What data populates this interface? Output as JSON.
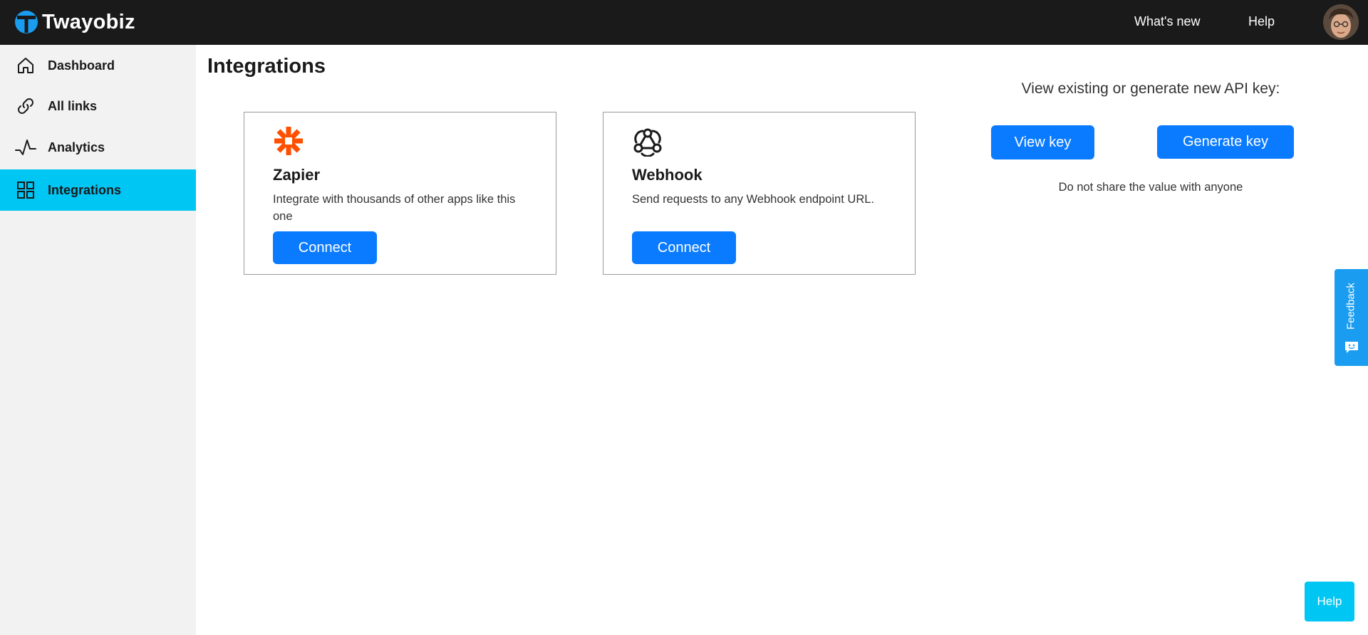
{
  "header": {
    "brand_name": "Twayobiz",
    "nav": {
      "whats_new": "What's new",
      "help": "Help"
    }
  },
  "sidebar": {
    "items": [
      {
        "label": "Dashboard",
        "icon": "home-icon",
        "active": false
      },
      {
        "label": "All links",
        "icon": "link-icon",
        "active": false
      },
      {
        "label": "Analytics",
        "icon": "pulse-icon",
        "active": false
      },
      {
        "label": "Integrations",
        "icon": "grid-icon",
        "active": true
      }
    ]
  },
  "main": {
    "title": "Integrations",
    "cards": [
      {
        "title": "Zapier",
        "icon": "zapier-asterisk-icon",
        "description": "Integrate with thousands of other apps like this one",
        "button": "Connect"
      },
      {
        "title": "Webhook",
        "icon": "webhook-icon",
        "description": "Send requests to any Webhook endpoint URL.",
        "button": "Connect"
      }
    ],
    "api": {
      "heading": "View existing or generate new API key:",
      "view_button": "View key",
      "generate_button": "Generate key",
      "note": "Do not share the value with anyone"
    }
  },
  "feedback_tab": {
    "label": "Feedback"
  },
  "help_button": {
    "label": "Help"
  },
  "colors": {
    "topbar": "#1a1a1a",
    "sidebar": "#f2f2f2",
    "active_item": "#00c6f3",
    "primary_button": "#0a7bff",
    "zapier_orange": "#ff4f00",
    "feedback_tab": "#1a9cf0"
  }
}
